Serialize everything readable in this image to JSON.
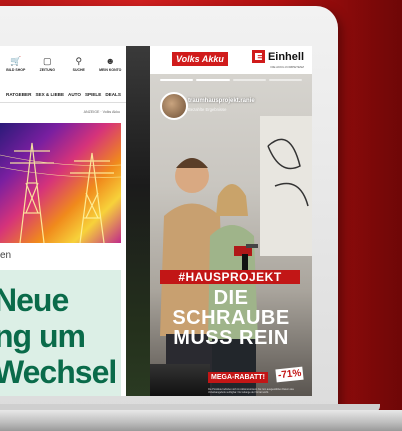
{
  "website": {
    "header_icons": [
      {
        "label": "BILD SHOP",
        "icon": "cart-icon"
      },
      {
        "label": "ZEITUNG",
        "icon": "newspaper-icon"
      },
      {
        "label": "SUCHE",
        "icon": "search-icon"
      },
      {
        "label": "MEIN KONTO",
        "icon": "user-icon"
      }
    ],
    "nav_items": [
      "RATGEBER",
      "SEX & LIEBE",
      "AUTO",
      "SPIELE",
      "DEALS"
    ],
    "ad_label": "ANZEIGE · Volks Akku",
    "caption_fragment": "en",
    "headline_lines": [
      "Neue",
      "ng um",
      "Wechsel"
    ]
  },
  "story_ad": {
    "brand_left": "Volks Akku",
    "brand_right": "Einhell",
    "brand_right_sub": "DIE AKKU-KOMPETENZ",
    "account_name": "traumhausprojekt.ranie",
    "account_sub": "Bezahlte Ergebnisse",
    "hashtag": "#HAUSPROJEKT",
    "headline_lines": [
      "DIE",
      "SCHRAUBE",
      "MUSS REIN"
    ],
    "promo_label": "MEGA-RABATT!",
    "discount": "-71%",
    "fine_print": "Die Produkte befinden sich im Aktionszeitraum bis zum ausgewählten Datum des Vorteilsangebots verfügbar. Nur solange der Vorrat reicht."
  },
  "colors": {
    "brand_red": "#c21616",
    "background_red": "#b81818",
    "headline_green": "#0a6b4a"
  }
}
